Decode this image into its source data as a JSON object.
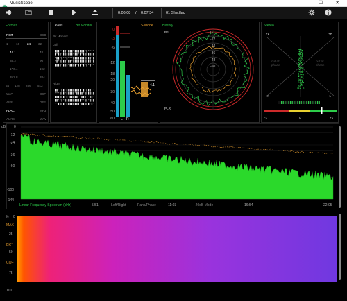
{
  "window": {
    "title": "MusicScope",
    "controls": {
      "minimize": "—",
      "maximize": "☐",
      "close": "✕"
    }
  },
  "toolbar": {
    "time_current": "0:06:08",
    "time_separator": "/",
    "time_total": "0:07:34",
    "track": "01 She.flac"
  },
  "format": {
    "title": "Format",
    "rows": [
      [
        "PCM",
        "DSD"
      ],
      [
        "1",
        "16",
        "24",
        "32"
      ],
      [
        "44.1",
        "48"
      ],
      [
        "88.2",
        "96"
      ],
      [
        "176.4",
        "192"
      ],
      [
        "352.8",
        "384"
      ],
      [
        "64",
        "128",
        "256",
        "512"
      ],
      [
        "WAV",
        "DSF"
      ],
      [
        "AIFF",
        "DFF"
      ],
      [
        "FLAC",
        "MP3"
      ],
      [
        "ALAC",
        "WAV"
      ]
    ]
  },
  "levels": {
    "title": "Levels",
    "subtitle": "Bit Monitor",
    "bit_monitor": "Bit Monitor",
    "left": "Left",
    "right": "Right"
  },
  "meter": {
    "smode": "S-Mode",
    "scale": [
      "0",
      "-3",
      "-6",
      "-12",
      "-18",
      "-20",
      "-30",
      "-40",
      "-50",
      "-60"
    ],
    "peak": "4.1",
    "ch_l": "L",
    "ch_r": "R"
  },
  "history": {
    "title": "History",
    "pl": "P/L",
    "plr": "PLR",
    "rings": [
      "0",
      "-12",
      "-24",
      "-36",
      "-48",
      "-60"
    ]
  },
  "stereo": {
    "title": "Stereo",
    "plus_l": "+L",
    "plus_r": "+R",
    "minus_l": "-L",
    "minus_r": "-R",
    "out1": "out of",
    "out2": "phase",
    "bottom_left": "-1",
    "bottom_mid": "0",
    "bottom_right": "+1"
  },
  "spectrum": {
    "ylabels": [
      "dB",
      "0",
      "-12",
      "-24",
      "-36",
      "-48",
      "-60",
      "-100",
      "-144"
    ],
    "xlabels": [
      "5:51",
      "11:03",
      "16:54",
      "22:05"
    ],
    "bottom": "Linear Frequency Spectrum (kHz)",
    "mode1": "Left/Right",
    "mode2": "Pans/Phase",
    "mode3": "-20dB Mode"
  },
  "spectrogram": {
    "ylabels": [
      "%",
      "0",
      "MAX",
      "25",
      "BRY",
      "50",
      "COF",
      "75",
      "100"
    ]
  },
  "colors": {
    "green": "#2dcc4a",
    "orange": "#e8a030",
    "red": "#cc2a2a",
    "cyan": "#1aa0c8"
  }
}
